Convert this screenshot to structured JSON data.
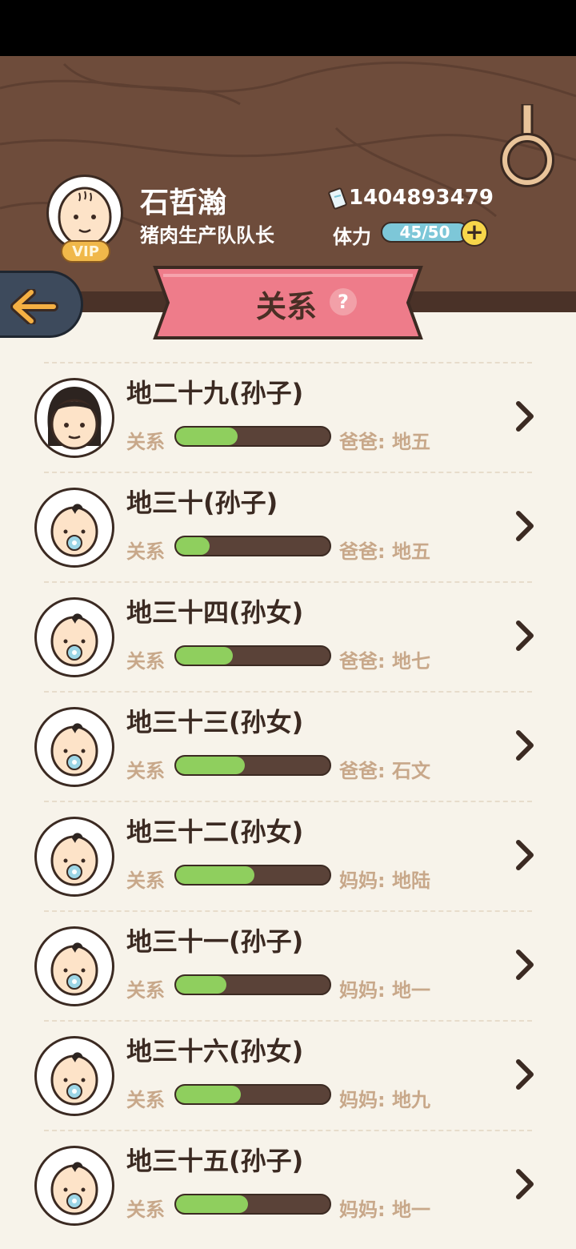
{
  "player": {
    "name": "石哲瀚",
    "title": "猪肉生产队队长",
    "vip_label": "VIP",
    "coins": "1404893479",
    "stamina_label": "体力",
    "stamina": "45/50"
  },
  "page": {
    "title": "关系",
    "help": "?"
  },
  "relation_label": "关系",
  "colors": {
    "header": "#6e4c3b",
    "banner": "#ee7c8a",
    "bar_fill": "#8fcf5e"
  },
  "rows": [
    {
      "name": "地二十九(孙子)",
      "relation": 0.4,
      "parent": "爸爸: 地五",
      "avatar": "adult-black-hair"
    },
    {
      "name": "地三十(孙子)",
      "relation": 0.22,
      "parent": "爸爸: 地五",
      "avatar": "baby-pacifier"
    },
    {
      "name": "地三十四(孙女)",
      "relation": 0.37,
      "parent": "爸爸: 地七",
      "avatar": "baby-pacifier"
    },
    {
      "name": "地三十三(孙女)",
      "relation": 0.45,
      "parent": "爸爸: 石文",
      "avatar": "baby-pacifier"
    },
    {
      "name": "地三十二(孙女)",
      "relation": 0.51,
      "parent": "妈妈: 地陆",
      "avatar": "baby-pacifier"
    },
    {
      "name": "地三十一(孙子)",
      "relation": 0.33,
      "parent": "妈妈: 地一",
      "avatar": "baby-pacifier"
    },
    {
      "name": "地三十六(孙女)",
      "relation": 0.42,
      "parent": "妈妈: 地九",
      "avatar": "baby-pacifier"
    },
    {
      "name": "地三十五(孙子)",
      "relation": 0.47,
      "parent": "妈妈: 地一",
      "avatar": "baby-pacifier"
    }
  ]
}
